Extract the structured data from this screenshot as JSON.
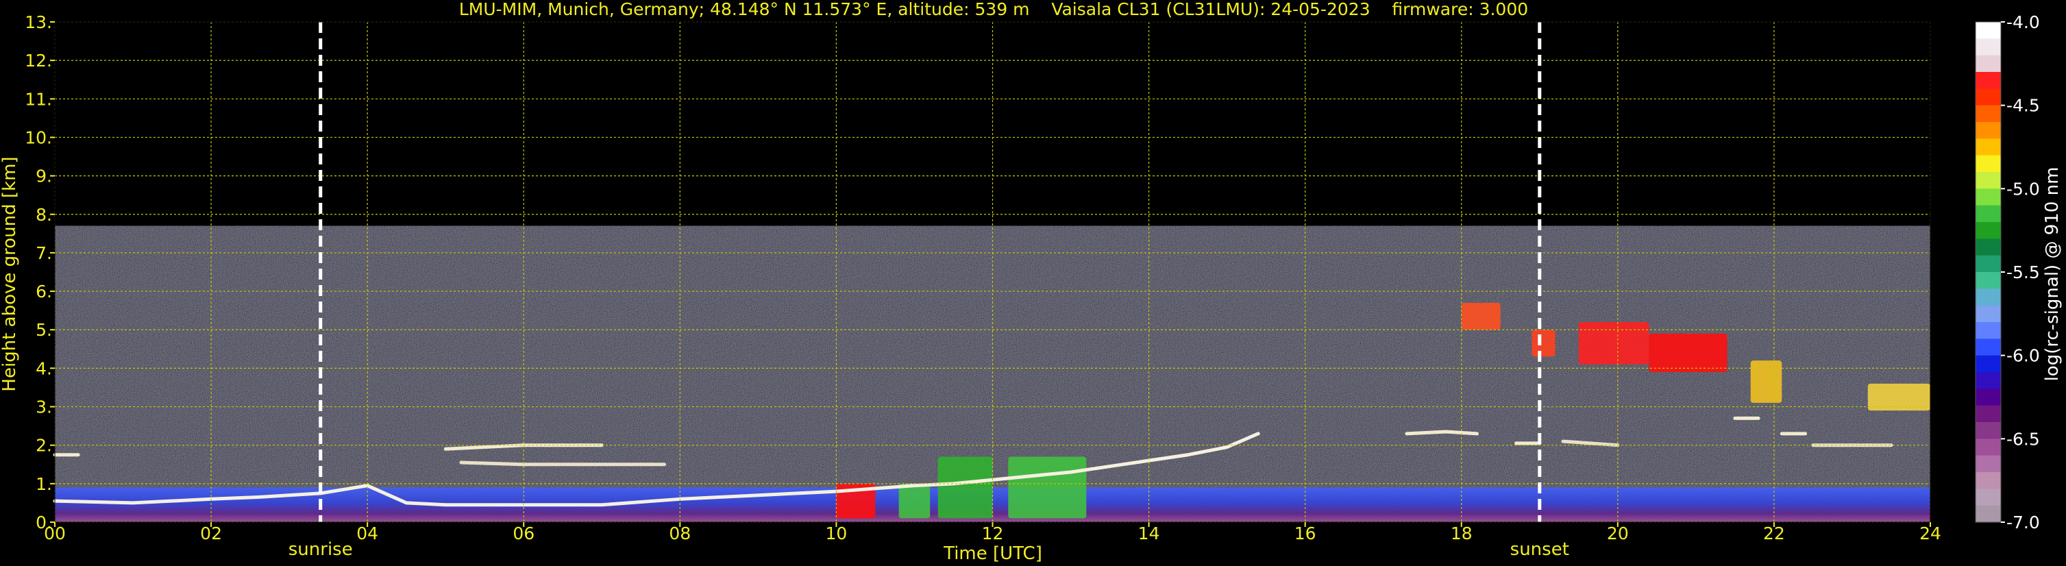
{
  "chart_data": {
    "type": "heatmap",
    "title": "LMU-MIM, Munich, Germany; 48.148° N 11.573° E, altitude: 539 m    Vaisala CL31 (CL31LMU): 24-05-2023    firmware: 3.000",
    "xlabel": "Time [UTC]",
    "ylabel": "Height above ground [km]",
    "xlim": [
      0,
      24
    ],
    "ylim": [
      0,
      13
    ],
    "grid": true,
    "x_ticks": [
      "00",
      "02",
      "04",
      "06",
      "08",
      "10",
      "12",
      "14",
      "16",
      "18",
      "20",
      "22",
      "24"
    ],
    "y_ticks": [
      "0.",
      "1.",
      "2.",
      "3.",
      "4.",
      "5.",
      "6.",
      "7.",
      "8.",
      "9.",
      "10.",
      "11.",
      "12.",
      "13."
    ],
    "annotations": [
      {
        "label": "sunrise",
        "x": 3.4
      },
      {
        "label": "sunset",
        "x": 19.0
      }
    ],
    "colorbar": {
      "label": "log(rc-signal) @ 910 nm",
      "range": [
        -7.0,
        -4.0
      ],
      "ticks": [
        "-4.0",
        "-4.5",
        "-5.0",
        "-5.5",
        "-6.0",
        "-6.5",
        "-7.0"
      ],
      "colors": [
        "#ffffff",
        "#f0e8ec",
        "#e8d0d8",
        "#ff2020",
        "#ff3000",
        "#ff6000",
        "#ff9000",
        "#ffc000",
        "#f8f020",
        "#c8f040",
        "#80e040",
        "#40c040",
        "#20a020",
        "#108040",
        "#20a070",
        "#40c090",
        "#60b0d0",
        "#80a0f0",
        "#6080ff",
        "#3050ff",
        "#1020e0",
        "#3010c0",
        "#500090",
        "#701880",
        "#883888",
        "#a05098",
        "#b070a8",
        "#c090b0",
        "#b8a0b8",
        "#a898a8"
      ]
    },
    "noise_top": 7.7,
    "layers": [
      {
        "name": "boundary",
        "color": "#f5f0e0",
        "points": [
          [
            0,
            0.55
          ],
          [
            1,
            0.5
          ],
          [
            2,
            0.6
          ],
          [
            2.6,
            0.65
          ],
          [
            3.4,
            0.75
          ],
          [
            4,
            0.95
          ],
          [
            4.5,
            0.5
          ],
          [
            5,
            0.45
          ],
          [
            6,
            0.45
          ],
          [
            7,
            0.45
          ],
          [
            8,
            0.6
          ],
          [
            9,
            0.7
          ],
          [
            10,
            0.8
          ],
          [
            11,
            0.95
          ],
          [
            11.5,
            1.0
          ],
          [
            12,
            1.1
          ],
          [
            13,
            1.3
          ],
          [
            13.5,
            1.45
          ],
          [
            14,
            1.6
          ],
          [
            14.5,
            1.75
          ],
          [
            15,
            1.95
          ],
          [
            15.4,
            2.3
          ]
        ]
      },
      {
        "name": "residual",
        "color": "#f0ead0",
        "points": [
          [
            0,
            1.75
          ],
          [
            0.3,
            1.75
          ]
        ]
      },
      {
        "name": "residual",
        "color": "#f0ead0",
        "points": [
          [
            5,
            1.9
          ],
          [
            6,
            2.0
          ],
          [
            7,
            2.0
          ]
        ]
      },
      {
        "name": "residual",
        "color": "#e8e0c8",
        "points": [
          [
            5.2,
            1.55
          ],
          [
            6,
            1.5
          ],
          [
            7,
            1.5
          ],
          [
            7.8,
            1.5
          ]
        ]
      },
      {
        "name": "residual",
        "color": "#f0ead0",
        "points": [
          [
            17.3,
            2.3
          ],
          [
            17.8,
            2.35
          ],
          [
            18.2,
            2.3
          ]
        ]
      },
      {
        "name": "residual",
        "color": "#f0ead0",
        "points": [
          [
            18.7,
            2.05
          ],
          [
            19.0,
            2.05
          ]
        ]
      },
      {
        "name": "residual",
        "color": "#e8e0c8",
        "points": [
          [
            19.3,
            2.1
          ],
          [
            20.0,
            2.0
          ]
        ]
      },
      {
        "name": "residual",
        "color": "#f0ead0",
        "points": [
          [
            21.5,
            2.7
          ],
          [
            21.8,
            2.7
          ]
        ]
      },
      {
        "name": "residual",
        "color": "#f0ead0",
        "points": [
          [
            22.1,
            2.3
          ],
          [
            22.4,
            2.3
          ]
        ]
      },
      {
        "name": "residual",
        "color": "#e8e0c8",
        "points": [
          [
            22.5,
            2.0
          ],
          [
            23.0,
            2.0
          ],
          [
            23.5,
            2.0
          ]
        ]
      }
    ],
    "clouds": [
      {
        "x": [
          18.0,
          18.5
        ],
        "y": [
          5.0,
          5.7
        ],
        "color": "#ff5020"
      },
      {
        "x": [
          18.9,
          19.2
        ],
        "y": [
          4.3,
          5.0
        ],
        "color": "#ff4020"
      },
      {
        "x": [
          19.5,
          20.4
        ],
        "y": [
          4.1,
          5.2
        ],
        "color": "#ff2020"
      },
      {
        "x": [
          20.4,
          21.4
        ],
        "y": [
          3.9,
          4.9
        ],
        "color": "#ff1010"
      },
      {
        "x": [
          21.7,
          22.1
        ],
        "y": [
          3.1,
          4.2
        ],
        "color": "#f0c020"
      },
      {
        "x": [
          23.2,
          24.0
        ],
        "y": [
          2.9,
          3.6
        ],
        "color": "#f0d040"
      },
      {
        "x": [
          10.0,
          10.5
        ],
        "y": [
          0.1,
          1.0
        ],
        "color": "#ff1010"
      },
      {
        "x": [
          10.8,
          11.2
        ],
        "y": [
          0.1,
          1.0
        ],
        "color": "#40c040"
      },
      {
        "x": [
          11.3,
          12.0
        ],
        "y": [
          0.1,
          1.7
        ],
        "color": "#30b030"
      },
      {
        "x": [
          12.2,
          13.2
        ],
        "y": [
          0.1,
          1.7
        ],
        "color": "#40c040"
      }
    ]
  }
}
